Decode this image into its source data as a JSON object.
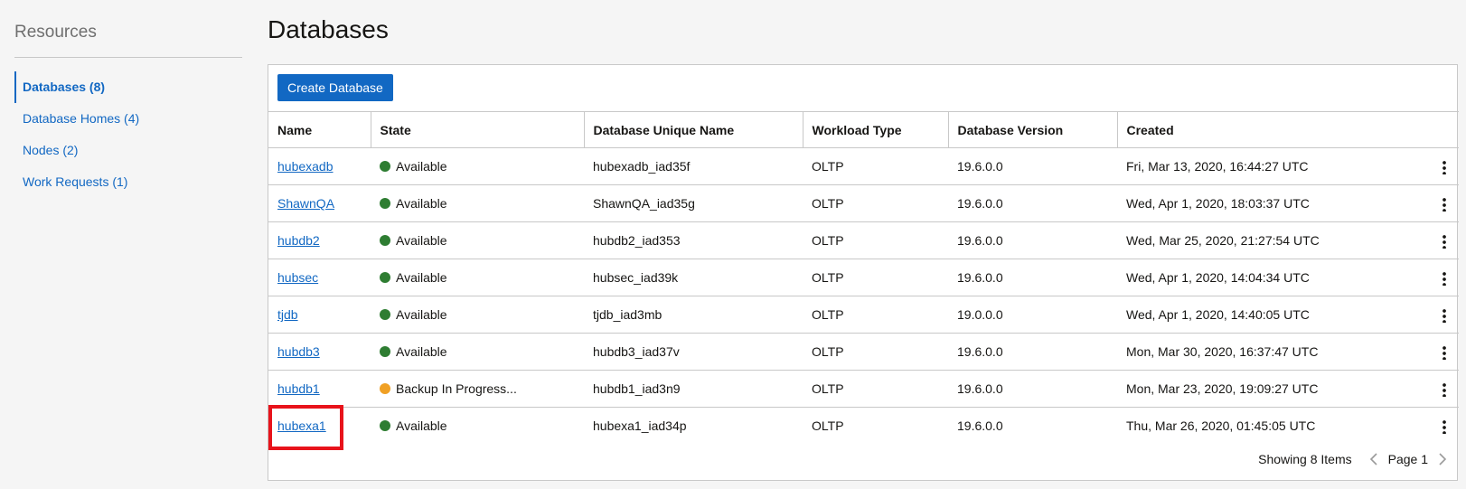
{
  "sidebar": {
    "title": "Resources",
    "items": [
      {
        "label": "Databases (8)",
        "active": true
      },
      {
        "label": "Database Homes (4)"
      },
      {
        "label": "Nodes (2)"
      },
      {
        "label": "Work Requests (1)"
      }
    ]
  },
  "page": {
    "title": "Databases"
  },
  "toolbar": {
    "create_label": "Create Database"
  },
  "table": {
    "columns": [
      "Name",
      "State",
      "Database Unique Name",
      "Workload Type",
      "Database Version",
      "Created"
    ],
    "rows": [
      {
        "name": "hubexadb",
        "state": "Available",
        "state_color": "#2e7d32",
        "unique_name": "hubexadb_iad35f",
        "workload": "OLTP",
        "version": "19.6.0.0",
        "created": "Fri, Mar 13, 2020, 16:44:27 UTC"
      },
      {
        "name": "ShawnQA",
        "state": "Available",
        "state_color": "#2e7d32",
        "unique_name": "ShawnQA_iad35g",
        "workload": "OLTP",
        "version": "19.6.0.0",
        "created": "Wed, Apr 1, 2020, 18:03:37 UTC"
      },
      {
        "name": "hubdb2",
        "state": "Available",
        "state_color": "#2e7d32",
        "unique_name": "hubdb2_iad353",
        "workload": "OLTP",
        "version": "19.6.0.0",
        "created": "Wed, Mar 25, 2020, 21:27:54 UTC"
      },
      {
        "name": "hubsec",
        "state": "Available",
        "state_color": "#2e7d32",
        "unique_name": "hubsec_iad39k",
        "workload": "OLTP",
        "version": "19.6.0.0",
        "created": "Wed, Apr 1, 2020, 14:04:34 UTC"
      },
      {
        "name": "tjdb",
        "state": "Available",
        "state_color": "#2e7d32",
        "unique_name": "tjdb_iad3mb",
        "workload": "OLTP",
        "version": "19.0.0.0",
        "created": "Wed, Apr 1, 2020, 14:40:05 UTC"
      },
      {
        "name": "hubdb3",
        "state": "Available",
        "state_color": "#2e7d32",
        "unique_name": "hubdb3_iad37v",
        "workload": "OLTP",
        "version": "19.6.0.0",
        "created": "Mon, Mar 30, 2020, 16:37:47 UTC"
      },
      {
        "name": "hubdb1",
        "state": "Backup In Progress...",
        "state_color": "#f0a024",
        "unique_name": "hubdb1_iad3n9",
        "workload": "OLTP",
        "version": "19.6.0.0",
        "created": "Mon, Mar 23, 2020, 19:09:27 UTC"
      },
      {
        "name": "hubexa1",
        "state": "Available",
        "state_color": "#2e7d32",
        "unique_name": "hubexa1_iad34p",
        "workload": "OLTP",
        "version": "19.6.0.0",
        "created": "Thu, Mar 26, 2020, 01:45:05 UTC"
      }
    ]
  },
  "footer": {
    "showing": "Showing 8 Items",
    "page": "Page 1"
  },
  "colors": {
    "accent": "#1268c3",
    "highlight": "#e8131b"
  }
}
